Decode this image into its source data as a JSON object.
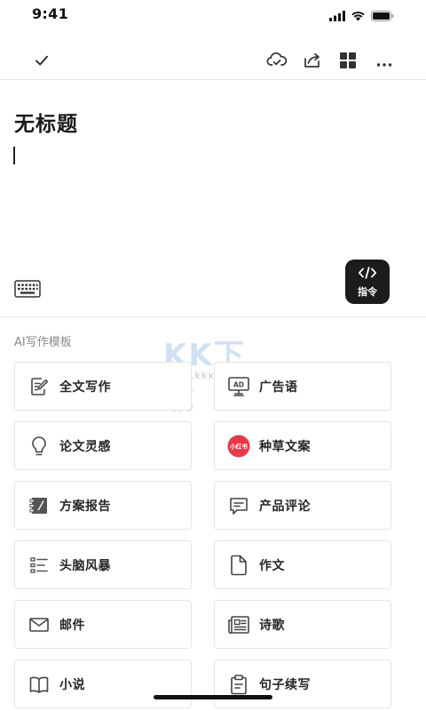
{
  "status_bar": {
    "time": "9:41",
    "icons": [
      "signal-icon",
      "wifi-icon",
      "battery-icon"
    ]
  },
  "toolbar": {
    "left": "check-icon",
    "right": [
      "cloud-sync-icon",
      "share-icon",
      "grid-icon",
      "more-icon"
    ]
  },
  "document": {
    "title": "无标题"
  },
  "command": {
    "label": "指令"
  },
  "section": {
    "label": "AI写作模板"
  },
  "watermark": {
    "brand": "KK下载",
    "url": "www.kkx.net"
  },
  "templates": [
    {
      "label": "全文写作",
      "icon": "edit-doc-icon"
    },
    {
      "label": "广告语",
      "icon": "ad-board-icon"
    },
    {
      "label": "论文灵感",
      "icon": "lightbulb-icon"
    },
    {
      "label": "种草文案",
      "icon": "xiaohongshu-icon",
      "badge": "小红书"
    },
    {
      "label": "方案报告",
      "icon": "report-icon"
    },
    {
      "label": "产品评论",
      "icon": "comment-icon"
    },
    {
      "label": "头脑风暴",
      "icon": "list-icon"
    },
    {
      "label": "作文",
      "icon": "document-icon"
    },
    {
      "label": "邮件",
      "icon": "mail-icon"
    },
    {
      "label": "诗歌",
      "icon": "newspaper-icon"
    },
    {
      "label": "小说",
      "icon": "book-icon"
    },
    {
      "label": "句子续写",
      "icon": "clipboard-icon"
    }
  ],
  "colors": {
    "accent_dark": "#1c1c1c",
    "xiaohongshu_red": "#e8394a",
    "icon_gray": "#444444"
  }
}
